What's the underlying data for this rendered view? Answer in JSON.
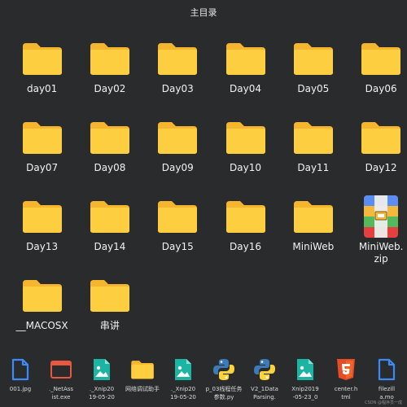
{
  "window": {
    "title": "主目录"
  },
  "colors": {
    "background": "#2a2b2d",
    "folder": "#fdcf40",
    "folder_back": "#f6b52f",
    "file_blue": "#3d8af7",
    "teal": "#1bb5a4",
    "html5": "#e44d26",
    "exe_red": "#e9573f"
  },
  "files": [
    {
      "name": "day01",
      "kind": "folder"
    },
    {
      "name": "Day02",
      "kind": "folder"
    },
    {
      "name": "Day03",
      "kind": "folder"
    },
    {
      "name": "Day04",
      "kind": "folder"
    },
    {
      "name": "Day05",
      "kind": "folder"
    },
    {
      "name": "Day06",
      "kind": "folder"
    },
    {
      "name": "Day07",
      "kind": "folder"
    },
    {
      "name": "Day08",
      "kind": "folder"
    },
    {
      "name": "Day09",
      "kind": "folder"
    },
    {
      "name": "Day10",
      "kind": "folder"
    },
    {
      "name": "Day11",
      "kind": "folder"
    },
    {
      "name": "Day12",
      "kind": "folder"
    },
    {
      "name": "Day13",
      "kind": "folder"
    },
    {
      "name": "Day14",
      "kind": "folder"
    },
    {
      "name": "Day15",
      "kind": "folder"
    },
    {
      "name": "Day16",
      "kind": "folder"
    },
    {
      "name": "MiniWeb",
      "kind": "folder"
    },
    {
      "name": "MiniWeb.\nzip",
      "kind": "zip"
    },
    {
      "name": "__MACOSX",
      "kind": "folder"
    },
    {
      "name": "串讲",
      "kind": "folder"
    }
  ],
  "bottom_files": [
    {
      "name": "001.jpg",
      "icon": "file-icon"
    },
    {
      "name": "._NetAss\nist.exe",
      "icon": "exe-window-icon"
    },
    {
      "name": "._Xnip20\n19-05-20",
      "icon": "image-icon"
    },
    {
      "name": "网络调试助手",
      "icon": "folder-icon"
    },
    {
      "name": "._Xnip20\n19-05-20",
      "icon": "image-icon"
    },
    {
      "name": "p_03线程任务\n参数.py",
      "icon": "python-icon"
    },
    {
      "name": "V2_1Data\nParsing.",
      "icon": "python-icon"
    },
    {
      "name": "Xnip2019\n-05-23_0",
      "icon": "image-icon"
    },
    {
      "name": "center.h\ntml",
      "icon": "html5-icon"
    },
    {
      "name": "filezill\na.mo",
      "icon": "file-icon"
    }
  ],
  "watermark": "CSDN @程序员一成"
}
